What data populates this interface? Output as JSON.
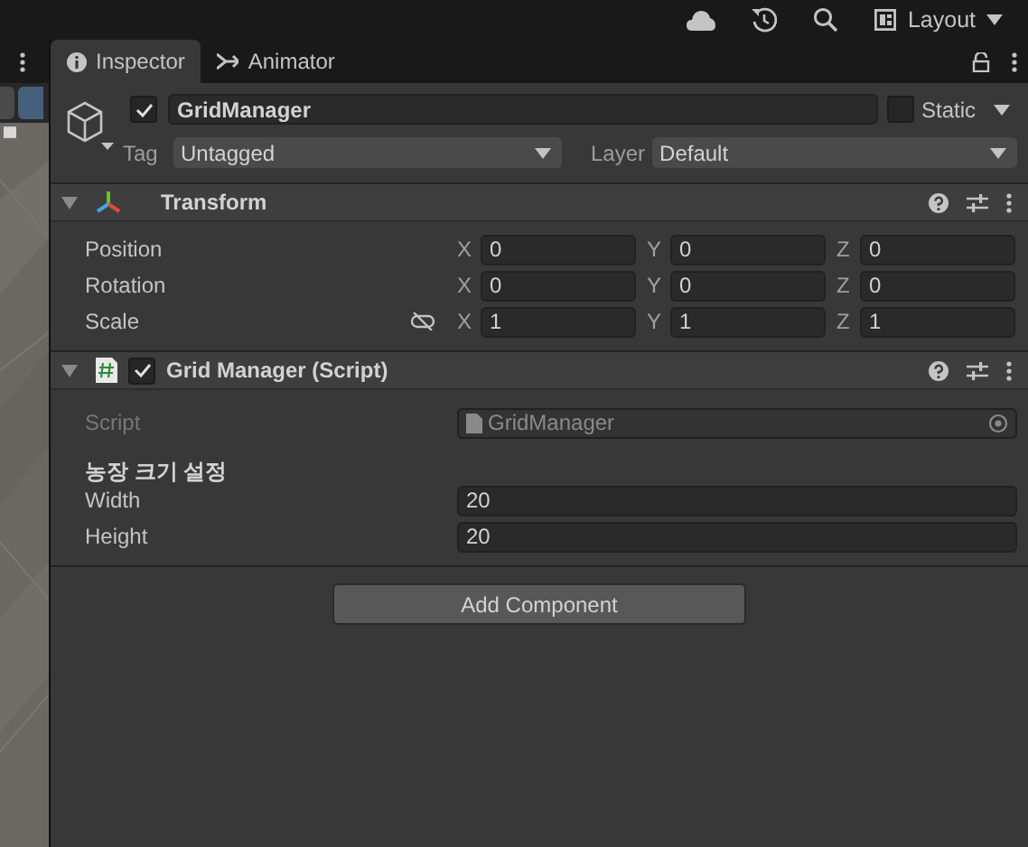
{
  "top_bar": {
    "layout_button": "Layout"
  },
  "tabs": [
    {
      "label": "Inspector",
      "selected": true,
      "kind": "info"
    },
    {
      "label": "Animator",
      "selected": false,
      "kind": "animator"
    }
  ],
  "game_object": {
    "active": true,
    "name": "GridManager",
    "static": false,
    "static_label": "Static",
    "tag_label": "Tag",
    "tag": "Untagged",
    "layer_label": "Layer",
    "layer": "Default"
  },
  "components": [
    {
      "kind": "transform",
      "title": "Transform",
      "expanded": true,
      "rows": [
        {
          "label": "Position",
          "fields": [
            {
              "axis": "X",
              "value": "0"
            },
            {
              "axis": "Y",
              "value": "0"
            },
            {
              "axis": "Z",
              "value": "0"
            }
          ]
        },
        {
          "label": "Rotation",
          "fields": [
            {
              "axis": "X",
              "value": "0"
            },
            {
              "axis": "Y",
              "value": "0"
            },
            {
              "axis": "Z",
              "value": "0"
            }
          ]
        },
        {
          "label": "Scale",
          "proportional": false,
          "fields": [
            {
              "axis": "X",
              "value": "1"
            },
            {
              "axis": "Y",
              "value": "1"
            },
            {
              "axis": "Z",
              "value": "1"
            }
          ]
        }
      ]
    },
    {
      "kind": "script",
      "title": "Grid Manager (Script)",
      "enabled": true,
      "expanded": true,
      "script_label": "Script",
      "script": "GridManager",
      "header": "농장 크기 설정",
      "fields": [
        {
          "label": "Width",
          "value": "20"
        },
        {
          "label": "Height",
          "value": "20"
        }
      ]
    }
  ],
  "add_component": "Add Component"
}
